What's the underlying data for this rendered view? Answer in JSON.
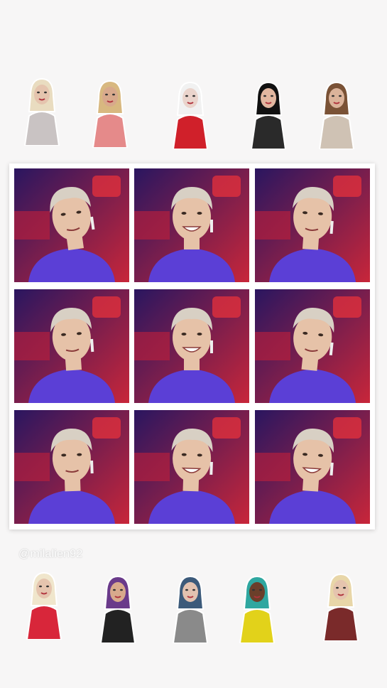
{
  "top_row": [
    {
      "name": "queen-1",
      "dress": "#c9c3c3",
      "hair": "#e9dcc0",
      "skin": "#e5c4ae"
    },
    {
      "name": "queen-2",
      "dress": "#e58a8a",
      "hair": "#d8b880",
      "skin": "#d8a98c"
    },
    {
      "name": "queen-3",
      "dress": "#d0202a",
      "hair": "#f1f1f1",
      "skin": "#ead4cc"
    },
    {
      "name": "queen-4",
      "dress": "#2a2a2a",
      "hair": "#111111",
      "skin": "#e2b7a0"
    },
    {
      "name": "queen-5",
      "dress": "#cfc2b4",
      "hair": "#7a5236",
      "skin": "#dbb39a"
    }
  ],
  "grid": {
    "tiles": [
      {
        "id": "r1c1"
      },
      {
        "id": "r1c2"
      },
      {
        "id": "r1c3"
      },
      {
        "id": "r2c1"
      },
      {
        "id": "r2c2"
      },
      {
        "id": "r2c3"
      },
      {
        "id": "r3c1"
      },
      {
        "id": "r3c2"
      },
      {
        "id": "r3c3"
      }
    ],
    "colors": {
      "shirt": "#5b3fd6",
      "hair": "#d8d0c4",
      "skin": "#e6c2a8",
      "bg1": "#2a1660",
      "bg2": "#c8263a"
    }
  },
  "watermark": "@milalien92",
  "bottom_row": [
    {
      "name": "queen-6",
      "dress": "#d8263a",
      "hair": "#f0e6cc",
      "skin": "#e5c4ae"
    },
    {
      "name": "queen-7",
      "dress": "#222222",
      "hair": "#6a3a8a",
      "skin": "#d8a98c"
    },
    {
      "name": "queen-8",
      "dress": "#8a8a8a",
      "hair": "#3c5a7a",
      "skin": "#e2c2b0"
    },
    {
      "name": "queen-9",
      "dress": "#e2d21a",
      "hair": "#2fa7a0",
      "skin": "#6b3f2a"
    },
    {
      "name": "queen-10",
      "dress": "#7a2a2a",
      "hair": "#e8d6a8",
      "skin": "#e5c4ae"
    }
  ]
}
